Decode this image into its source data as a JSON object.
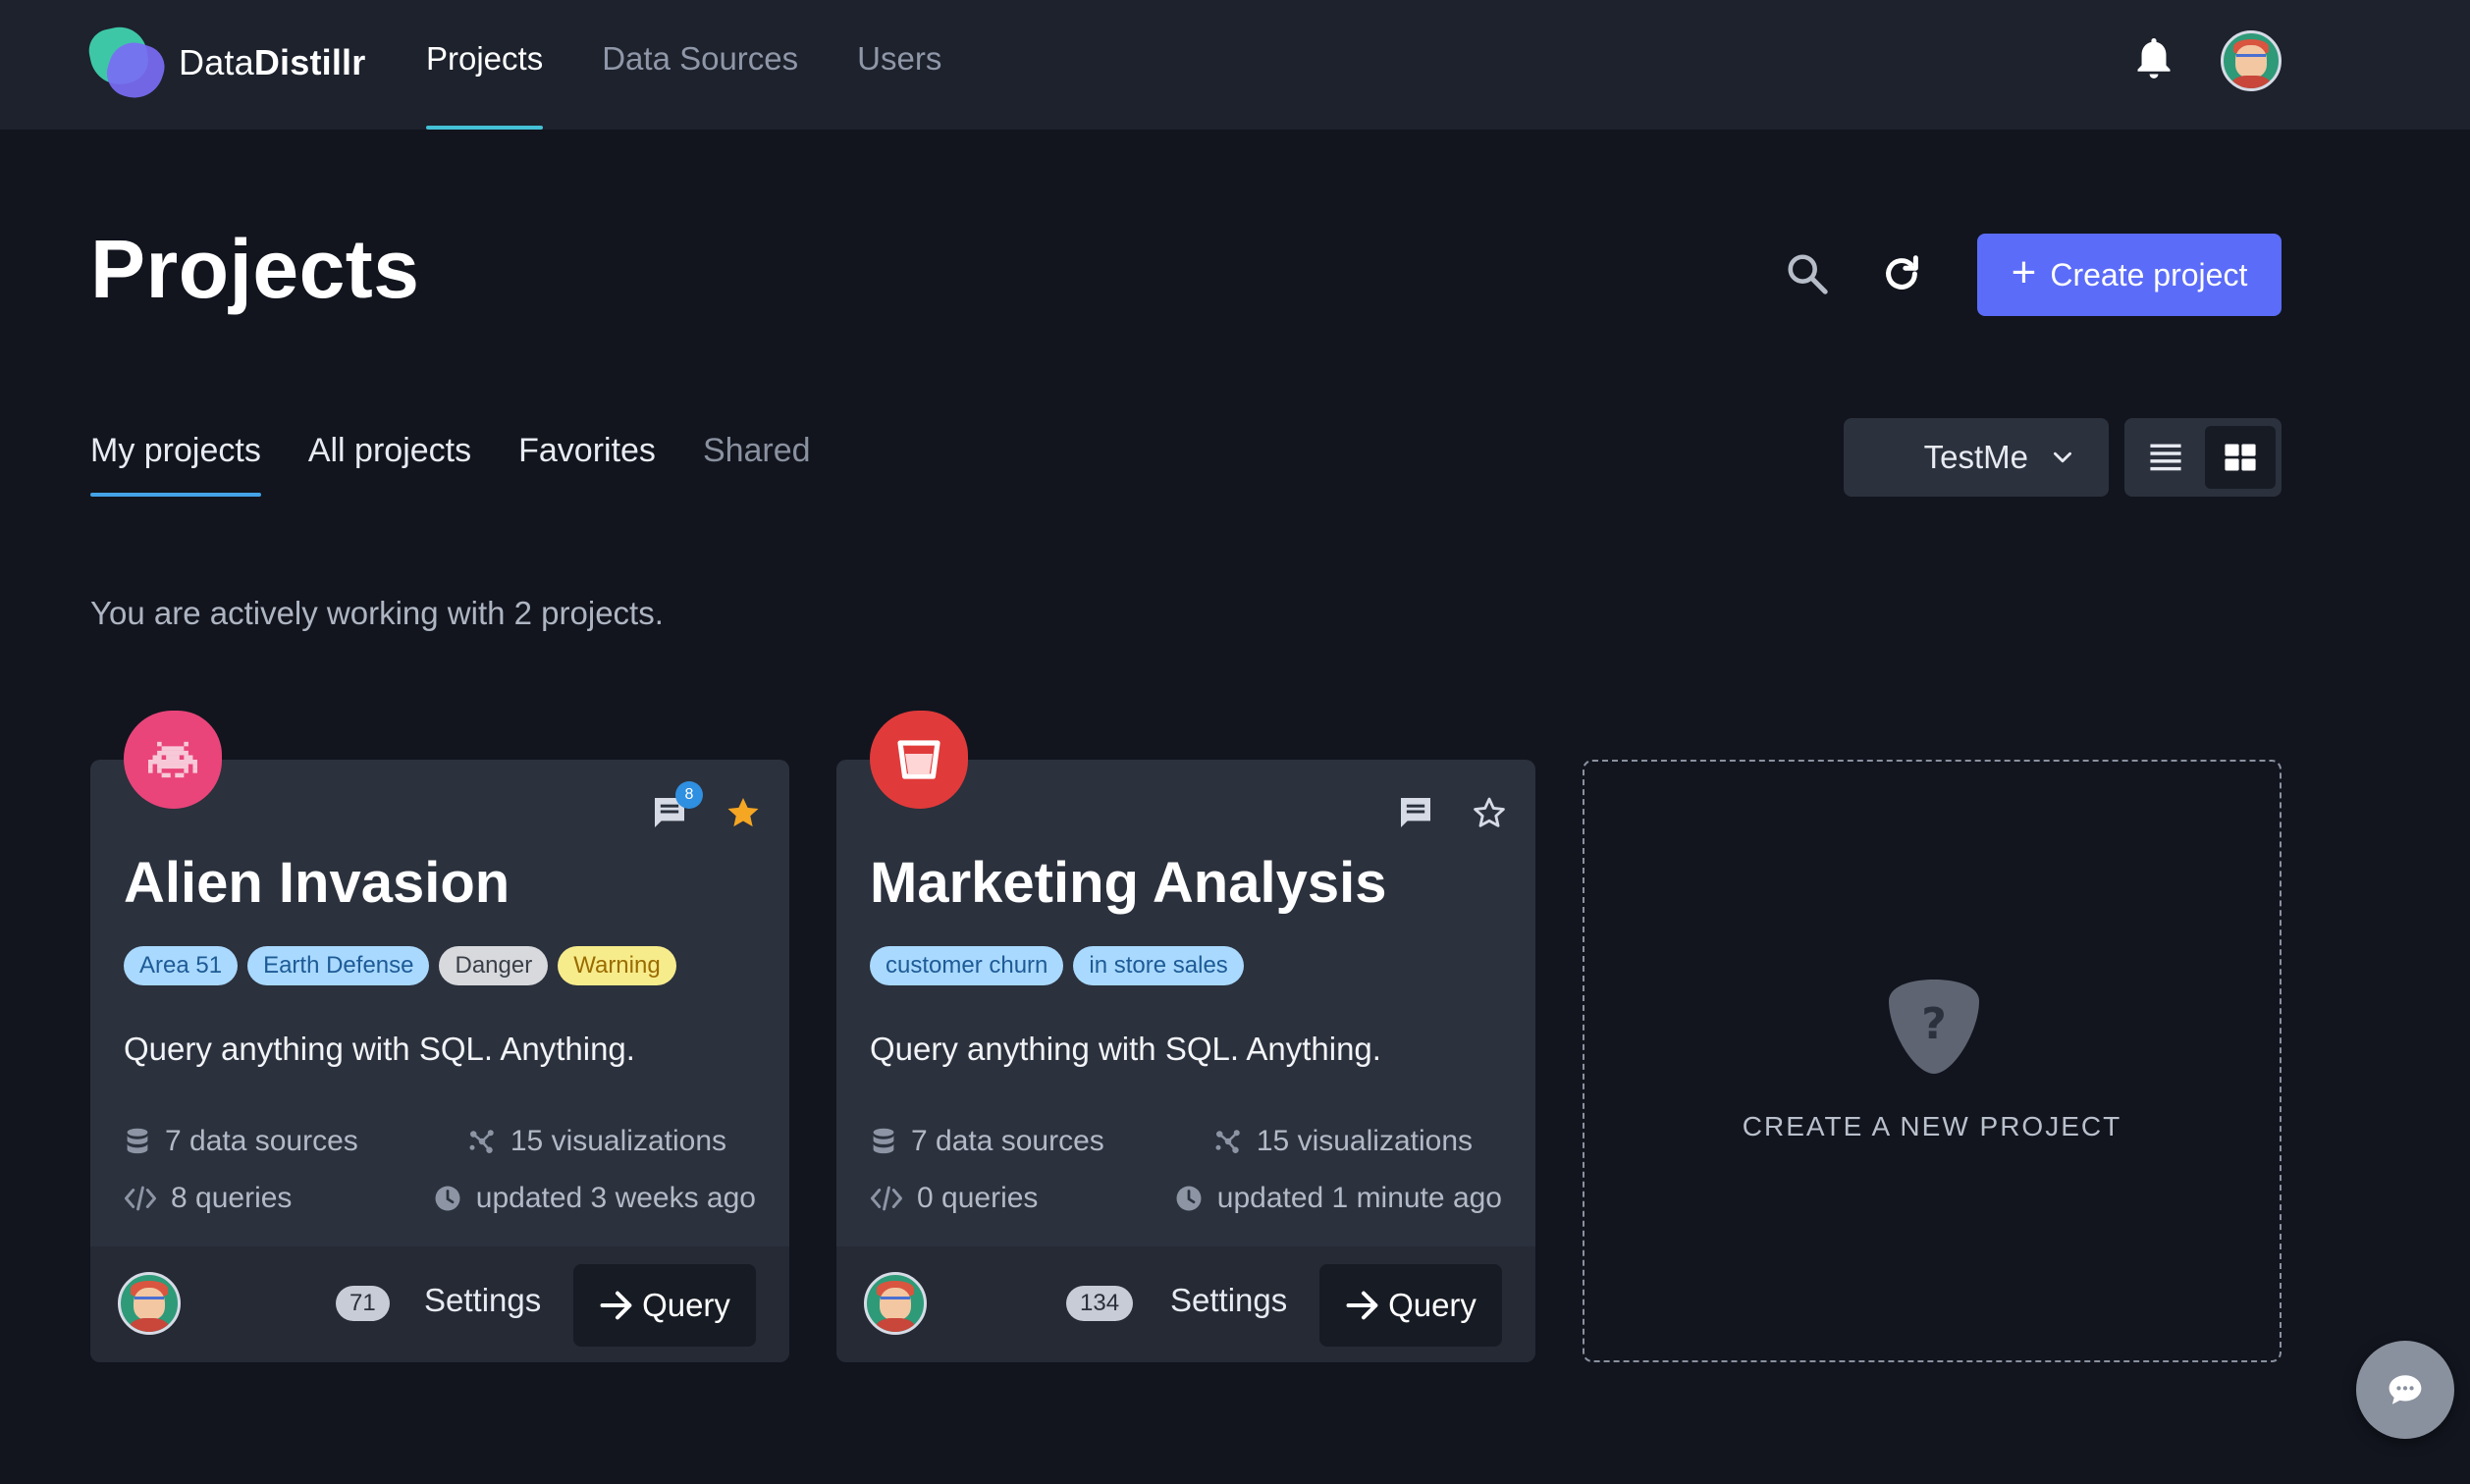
{
  "app": {
    "brand_regular": "Data",
    "brand_bold": "Distillr",
    "nav": [
      {
        "label": "Projects",
        "active": true
      },
      {
        "label": "Data Sources",
        "active": false
      },
      {
        "label": "Users",
        "active": false
      }
    ]
  },
  "header": {
    "title": "Projects",
    "create_label": "Create project"
  },
  "tabs": [
    {
      "label": "My projects",
      "active": true
    },
    {
      "label": "All projects",
      "active": false
    },
    {
      "label": "Favorites",
      "active": false
    },
    {
      "label": "Shared",
      "active": false
    }
  ],
  "workspace_select": {
    "value": "TestMe"
  },
  "view_mode": "grid",
  "summary": "You are actively working with 2 projects.",
  "projects": [
    {
      "title": "Alien Invasion",
      "icon": "alien-invader-icon",
      "blob_color": "#e9457a",
      "comment_count": "8",
      "favorite": true,
      "tags": [
        {
          "label": "Area 51",
          "style": "blue"
        },
        {
          "label": "Earth Defense",
          "style": "blue"
        },
        {
          "label": "Danger",
          "style": "grey"
        },
        {
          "label": "Warning",
          "style": "yellow"
        }
      ],
      "description": "Query anything with SQL. Anything.",
      "data_sources": "7 data sources",
      "visualizations": "15 visualizations",
      "queries": "8 queries",
      "updated": "updated 3 weeks ago",
      "member_count": "71",
      "settings_label": "Settings",
      "query_label": "Query"
    },
    {
      "title": "Marketing Analysis",
      "icon": "shopping-bucket-icon",
      "blob_color": "#e13a3a",
      "comment_count": "",
      "favorite": false,
      "tags": [
        {
          "label": "customer churn",
          "style": "blue"
        },
        {
          "label": "in store sales",
          "style": "blue"
        }
      ],
      "description": "Query anything with SQL. Anything.",
      "data_sources": "7 data sources",
      "visualizations": "15 visualizations",
      "queries": "0 queries",
      "updated": "updated 1 minute ago",
      "member_count": "134",
      "settings_label": "Settings",
      "query_label": "Query"
    }
  ],
  "new_project_label": "CREATE A NEW PROJECT",
  "colors": {
    "accent": "#5b6cf8",
    "nav_underline": "#44c1d6",
    "favorite_star": "#f5a623"
  }
}
